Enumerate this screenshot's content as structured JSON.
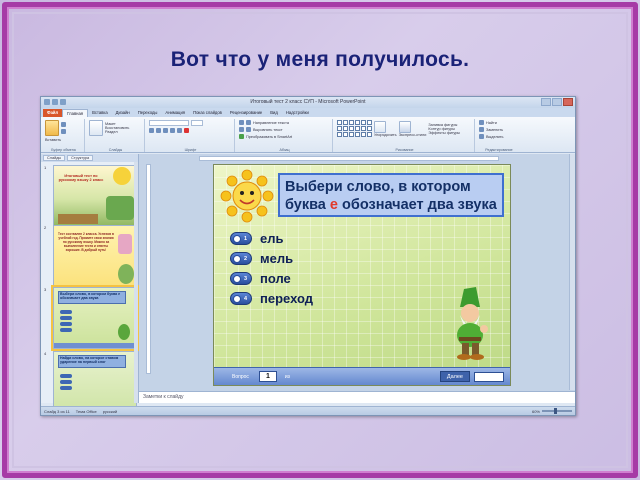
{
  "slide_title": "Вот что у меня получилось.",
  "app": {
    "window_title": "Итоговый тест 2 класс СУП - Microsoft PowerPoint",
    "tabs": [
      "Файл",
      "Главная",
      "Вставка",
      "Дизайн",
      "Переходы",
      "Анимация",
      "Показ слайдов",
      "Рецензирование",
      "Вид",
      "Надстройки"
    ],
    "ribbon": {
      "paste": "Вставить",
      "layout": "Макет",
      "reset": "Восстановить",
      "section": "Раздел",
      "new_slide": "Создать слайд",
      "text_direction": "Направление текста",
      "align_text": "Выровнять текст",
      "smartart": "Преобразовать в SmartArt",
      "arrange": "Упорядочить",
      "quick_styles": "Экспресс-стили",
      "shape_fill": "Заливка фигуры",
      "shape_outline": "Контур фигуры",
      "shape_effects": "Эффекты фигуры",
      "find": "Найти",
      "replace": "Заменить",
      "select": "Выделить",
      "groups": [
        "Буфер обмена",
        "Слайды",
        "Шрифт",
        "Абзац",
        "Рисование",
        "Редактирование"
      ]
    },
    "thumb_tabs": [
      "Слайды",
      "Структура"
    ],
    "thumbnails": [
      {
        "num": "1",
        "caption": "Итоговый тест по русскому языку 2 класс"
      },
      {
        "num": "2",
        "caption": "Тест составлен 2 класса. Успехов в учебной год. Примите свои знания по русскому языку. Можно за выполнение теста и ответы хорошие. В добрый путь!"
      },
      {
        "num": "3",
        "caption": "Выбери слово, в котором буква е обозначает два звука"
      },
      {
        "num": "4",
        "caption": "Найди слово, на которое ставим ударение на первый слог"
      }
    ],
    "question": {
      "before": "Выбери слово, в котором буква ",
      "highlight": "е",
      "after": " обозначает два звука"
    },
    "answers": [
      {
        "num": "1",
        "text": "ель"
      },
      {
        "num": "2",
        "text": "мель"
      },
      {
        "num": "3",
        "text": "поле"
      },
      {
        "num": "4",
        "text": "переход"
      }
    ],
    "nav": {
      "label_left": "Вопрос",
      "current": "1",
      "label_mid": "из",
      "next": "Далее"
    },
    "notes_placeholder": "Заметки к слайду",
    "status": {
      "slide": "Слайд 3 из 11",
      "theme": "Тема Office",
      "language": "русский",
      "zoom": "60%"
    }
  },
  "colors": {
    "frame": "#a63ba6",
    "title": "#1a2277",
    "question_border": "#3f6fcf",
    "highlight": "#e23a2a"
  }
}
